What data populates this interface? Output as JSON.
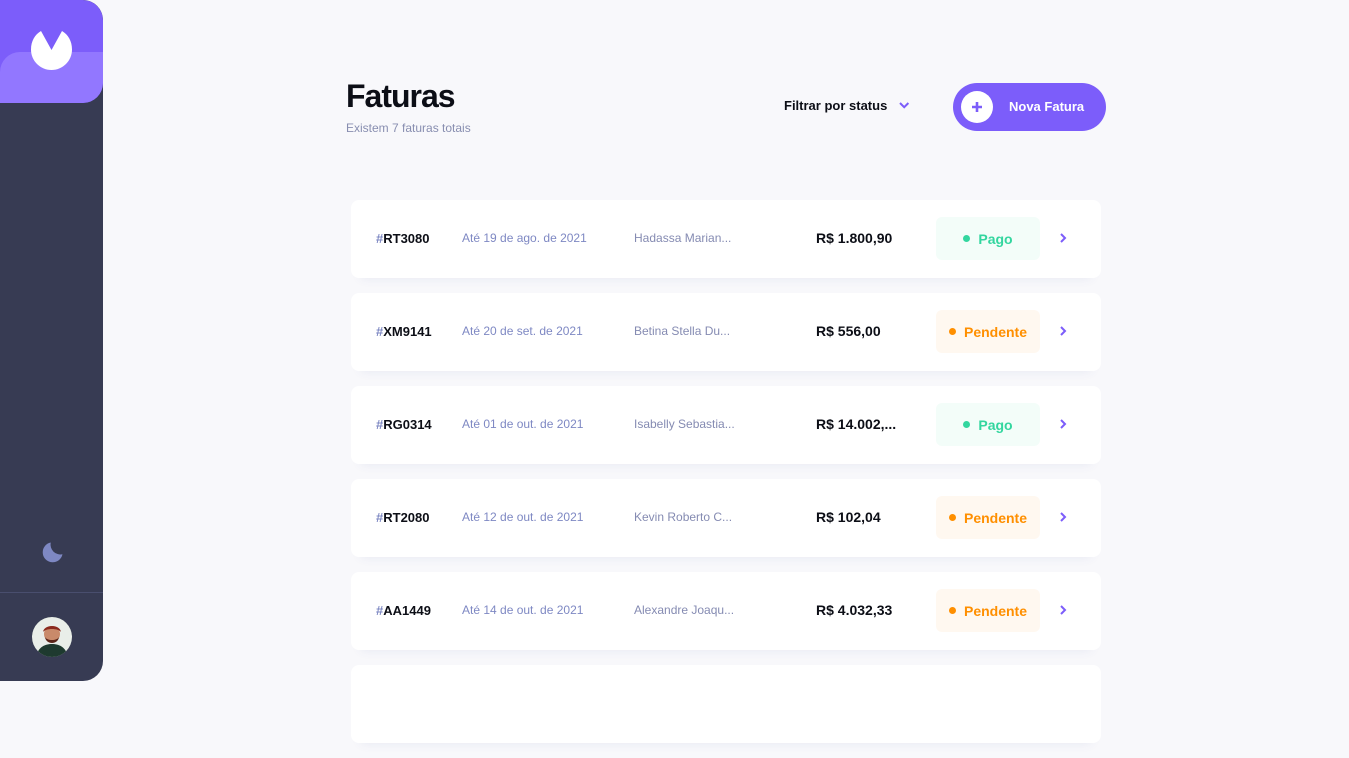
{
  "header": {
    "title": "Faturas",
    "subtitle": "Existem 7 faturas totais",
    "filter_label": "Filtrar por status",
    "new_invoice_label": "Nova Fatura"
  },
  "sidebar": {
    "logo_icon": "logo-icon",
    "theme_icon": "moon-icon",
    "avatar_icon": "user-avatar"
  },
  "colors": {
    "accent": "#7C5DFA",
    "accent_light": "#9277FF",
    "sidebar_bg": "#373B53",
    "page_bg": "#F8F8FB",
    "paid": "#33D69F",
    "pending": "#FF8F00"
  },
  "invoices": [
    {
      "hash": "#",
      "id": "RT3080",
      "due": "Até 19 de ago. de 2021",
      "client": "Hadassa Marian...",
      "amount": "R$ 1.800,90",
      "status": "Pago",
      "status_key": "pago"
    },
    {
      "hash": "#",
      "id": "XM9141",
      "due": "Até 20 de set. de 2021",
      "client": "Betina Stella Du...",
      "amount": "R$ 556,00",
      "status": "Pendente",
      "status_key": "pendente"
    },
    {
      "hash": "#",
      "id": "RG0314",
      "due": "Até 01 de out. de 2021",
      "client": "Isabelly Sebastia...",
      "amount": "R$ 14.002,...",
      "status": "Pago",
      "status_key": "pago"
    },
    {
      "hash": "#",
      "id": "RT2080",
      "due": "Até 12 de out. de 2021",
      "client": "Kevin Roberto C...",
      "amount": "R$ 102,04",
      "status": "Pendente",
      "status_key": "pendente"
    },
    {
      "hash": "#",
      "id": "AA1449",
      "due": "Até 14 de out. de 2021",
      "client": "Alexandre Joaqu...",
      "amount": "R$ 4.032,33",
      "status": "Pendente",
      "status_key": "pendente"
    },
    {
      "hash": "",
      "id": "",
      "due": "",
      "client": "",
      "amount": "",
      "status": "",
      "status_key": ""
    }
  ]
}
